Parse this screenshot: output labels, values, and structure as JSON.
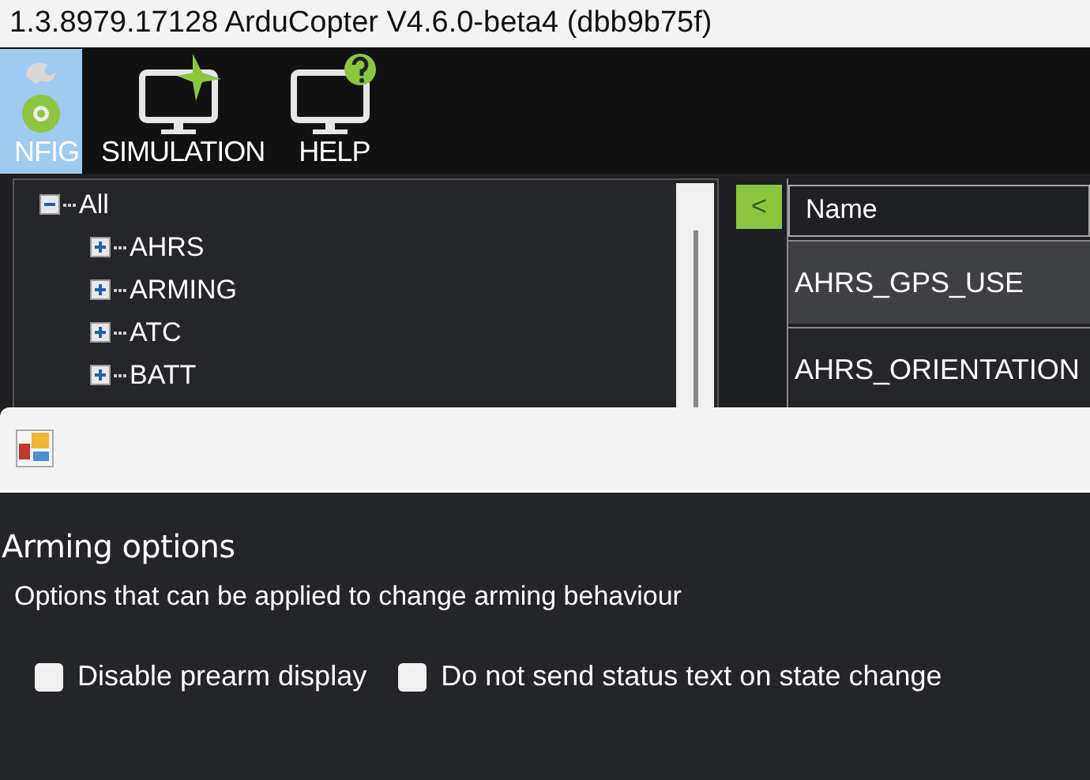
{
  "window": {
    "title": "1.3.8979.17128 ArduCopter V4.6.0-beta4 (dbb9b75f)"
  },
  "toolbar": [
    {
      "label": "NFIG",
      "kind": "config",
      "selected": true
    },
    {
      "label": "SIMULATION",
      "kind": "simulation",
      "selected": false
    },
    {
      "label": "HELP",
      "kind": "help",
      "selected": false
    }
  ],
  "tree": [
    {
      "label": "All",
      "expanded": true,
      "children": [
        {
          "label": "AHRS",
          "expanded": false
        },
        {
          "label": "ARMING",
          "expanded": false
        },
        {
          "label": "ATC",
          "expanded": false
        },
        {
          "label": "BATT",
          "expanded": false
        }
      ]
    }
  ],
  "collapse_button": "<",
  "table": {
    "columns": [
      "Name"
    ],
    "rows": [
      {
        "name": "AHRS_GPS_USE",
        "selected": true
      },
      {
        "name": "AHRS_ORIENTATION",
        "selected": false
      }
    ]
  },
  "dialog": {
    "heading": "Arming options",
    "description": "Options that can be applied to change arming behaviour",
    "options": [
      {
        "label": "Disable prearm display",
        "checked": false
      },
      {
        "label": "Do not send status text on state change",
        "checked": false
      }
    ]
  }
}
